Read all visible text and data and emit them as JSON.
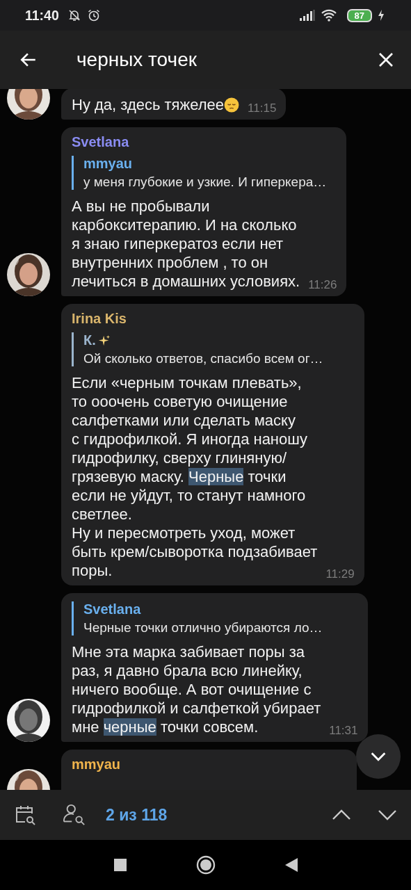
{
  "status_bar": {
    "time": "11:40",
    "battery": "87"
  },
  "header": {
    "query": "черных точек"
  },
  "messages": [
    {
      "avatar": true,
      "body": [
        [
          {
            "text": "Ну да, здесь тяжелее",
            "highlighted": false
          }
        ]
      ],
      "emoji": true,
      "time": "11:15"
    },
    {
      "avatar": true,
      "sender": {
        "name": "Svetlana",
        "color": "#8a8cf2"
      },
      "reply": {
        "name": "mmyau",
        "text": "у меня глубокие и узкие. И гиперкера…",
        "color": "#6ab0ee",
        "sparkle": false
      },
      "body": [
        [
          {
            "text": "А вы не пробывали",
            "highlighted": false
          }
        ],
        [
          {
            "text": "карбокситерапию. И на сколько",
            "highlighted": false
          }
        ],
        [
          {
            "text": "я знаю гиперкератоз если нет",
            "highlighted": false
          }
        ],
        [
          {
            "text": "внутренних проблем , то он",
            "highlighted": false
          }
        ],
        [
          {
            "text": "лечиться в домашних условиях.",
            "highlighted": false
          }
        ]
      ],
      "time": "11:26"
    },
    {
      "avatar": false,
      "sender": {
        "name": "Irina Kis",
        "color": "#d9b56c"
      },
      "reply": {
        "name": "К.",
        "text": "Ой сколько ответов, спасибо всем ог…",
        "color": "#9bb4cc",
        "sparkle": true
      },
      "body": [
        [
          {
            "text": "Если «черным точкам плевать»,",
            "highlighted": false
          }
        ],
        [
          {
            "text": "то ооочень советую очищение",
            "highlighted": false
          }
        ],
        [
          {
            "text": "салфетками или сделать маску",
            "highlighted": false
          }
        ],
        [
          {
            "text": "с гидрофилкой. Я иногда наношу",
            "highlighted": false
          }
        ],
        [
          {
            "text": "гидрофилку, сверху глиняную/",
            "highlighted": false
          }
        ],
        [
          {
            "text": "грязевую маску. ",
            "highlighted": false
          },
          {
            "text": "Черные",
            "highlighted": true
          },
          {
            "text": " точки",
            "highlighted": false
          }
        ],
        [
          {
            "text": "если не уйдут, то станут намного",
            "highlighted": false
          }
        ],
        [
          {
            "text": "светлее.",
            "highlighted": false
          }
        ],
        [
          {
            "text": "Ну и пересмотреть уход, может",
            "highlighted": false
          }
        ],
        [
          {
            "text": "быть крем/сыворотка подзабивает",
            "highlighted": false
          }
        ],
        [
          {
            "text": "поры.",
            "highlighted": false
          }
        ]
      ],
      "time": "11:29"
    },
    {
      "avatar": true,
      "reply": {
        "name": "Svetlana",
        "text": "Черные точки отлично убираются ло…",
        "color": "#6ab0ee",
        "sparkle": false
      },
      "body": [
        [
          {
            "text": "Мне эта марка забивает поры за",
            "highlighted": false
          }
        ],
        [
          {
            "text": "раз, я давно брала всю линейку,",
            "highlighted": false
          }
        ],
        [
          {
            "text": "ничего вообще. А вот очищение с",
            "highlighted": false
          }
        ],
        [
          {
            "text": "гидрофилкой и салфеткой убирает",
            "highlighted": false
          }
        ],
        [
          {
            "text": "мне ",
            "highlighted": false
          },
          {
            "text": "черные",
            "highlighted": true
          },
          {
            "text": " точки совсем.",
            "highlighted": false
          }
        ]
      ],
      "time": "11:31"
    },
    {
      "avatar": true,
      "sender": {
        "name": "mmyau",
        "color": "#f0b44c"
      }
    }
  ],
  "search_bar": {
    "counter": "2 из 118"
  }
}
